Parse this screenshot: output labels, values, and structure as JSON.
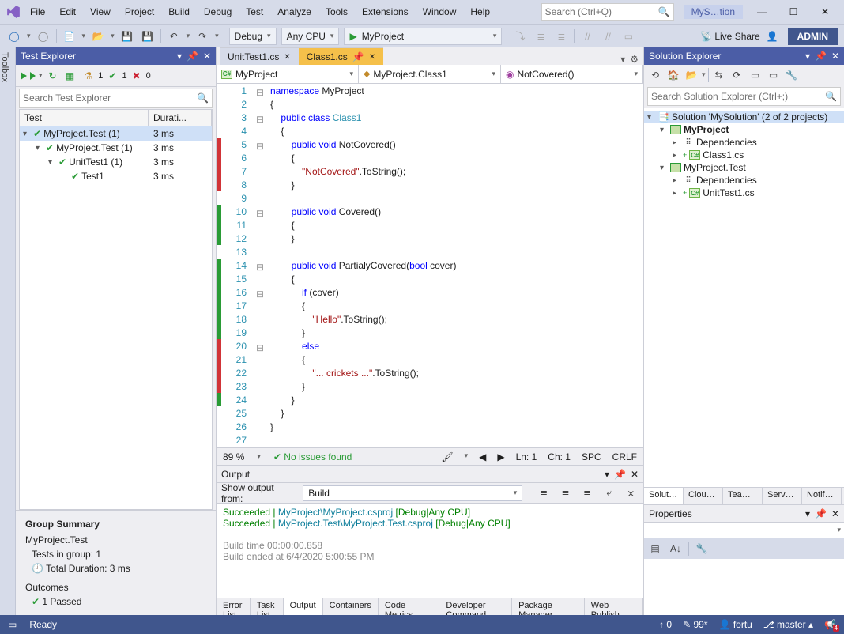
{
  "title_bar": {
    "solution_name": "MyS…tion"
  },
  "menu": [
    "File",
    "Edit",
    "View",
    "Project",
    "Build",
    "Debug",
    "Test",
    "Analyze",
    "Tools",
    "Extensions",
    "Window",
    "Help"
  ],
  "title_search_placeholder": "Search (Ctrl+Q)",
  "toolbar": {
    "config": "Debug",
    "platform": "Any CPU",
    "start_project": "MyProject",
    "live_share": "Live Share",
    "admin": "ADMIN"
  },
  "toolbox_label": "Toolbox",
  "test_explorer": {
    "title": "Test Explorer",
    "counts": {
      "flask": "1",
      "pass": "1",
      "fail": "0"
    },
    "search_placeholder": "Search Test Explorer",
    "col_test": "Test",
    "col_dur": "Durati...",
    "rows": [
      {
        "indent": 0,
        "name": "MyProject.Test  (1)",
        "dur": "3 ms",
        "sel": true
      },
      {
        "indent": 1,
        "name": "MyProject.Test  (1)",
        "dur": "3 ms"
      },
      {
        "indent": 2,
        "name": "UnitTest1  (1)",
        "dur": "3 ms"
      },
      {
        "indent": 3,
        "name": "Test1",
        "dur": "3 ms",
        "leaf": true
      }
    ],
    "summary": {
      "title": "Group Summary",
      "group": "MyProject.Test",
      "tests_in_group": "Tests in group:  1",
      "total_duration": "Total Duration:  3  ms",
      "outcomes": "Outcomes",
      "passed": "1  Passed"
    }
  },
  "doc_tabs": [
    {
      "label": "UnitTest1.cs",
      "active": false
    },
    {
      "label": "Class1.cs",
      "active": true
    }
  ],
  "nav": {
    "scope": "MyProject",
    "class": "MyProject.Class1",
    "member": "NotCovered()"
  },
  "code": [
    {
      "n": 1,
      "cov": "",
      "o": "⊟",
      "h": "<span class='kw'>namespace</span> MyProject"
    },
    {
      "n": 2,
      "cov": "",
      "o": "",
      "h": "{"
    },
    {
      "n": 3,
      "cov": "",
      "o": "⊟",
      "h": "    <span class='kw'>public</span> <span class='kw'>class</span> <span class='cls'>Class1</span>"
    },
    {
      "n": 4,
      "cov": "",
      "o": "",
      "h": "    {"
    },
    {
      "n": 5,
      "cov": "#d13438",
      "o": "⊟",
      "h": "        <span class='kw'>public</span> <span class='kw'>void</span> NotCovered()"
    },
    {
      "n": 6,
      "cov": "#d13438",
      "o": "",
      "h": "        {"
    },
    {
      "n": 7,
      "cov": "#d13438",
      "o": "",
      "h": "            <span class='str'>\"NotCovered\"</span>.ToString();"
    },
    {
      "n": 8,
      "cov": "#d13438",
      "o": "",
      "h": "        }"
    },
    {
      "n": 9,
      "cov": "",
      "o": "",
      "h": ""
    },
    {
      "n": 10,
      "cov": "#2a9b36",
      "o": "⊟",
      "h": "        <span class='kw'>public</span> <span class='kw'>void</span> Covered()"
    },
    {
      "n": 11,
      "cov": "#2a9b36",
      "o": "",
      "h": "        {"
    },
    {
      "n": 12,
      "cov": "#2a9b36",
      "o": "",
      "h": "        }"
    },
    {
      "n": 13,
      "cov": "",
      "o": "",
      "h": ""
    },
    {
      "n": 14,
      "cov": "#2a9b36",
      "o": "⊟",
      "h": "        <span class='kw'>public</span> <span class='kw'>void</span> PartialyCovered(<span class='kw'>bool</span> cover)"
    },
    {
      "n": 15,
      "cov": "#2a9b36",
      "o": "",
      "h": "        {"
    },
    {
      "n": 16,
      "cov": "#2a9b36",
      "o": "⊟",
      "h": "            <span class='kw'>if</span> (cover)"
    },
    {
      "n": 17,
      "cov": "#2a9b36",
      "o": "",
      "h": "            {"
    },
    {
      "n": 18,
      "cov": "#2a9b36",
      "o": "",
      "h": "                <span class='str'>\"Hello\"</span>.ToString();"
    },
    {
      "n": 19,
      "cov": "#2a9b36",
      "o": "",
      "h": "            }"
    },
    {
      "n": 20,
      "cov": "#d13438",
      "o": "⊟",
      "h": "            <span class='kw'>else</span>"
    },
    {
      "n": 21,
      "cov": "#d13438",
      "o": "",
      "h": "            {"
    },
    {
      "n": 22,
      "cov": "#d13438",
      "o": "",
      "h": "                <span class='str'>\"... crickets ...\"</span>.ToString();"
    },
    {
      "n": 23,
      "cov": "#d13438",
      "o": "",
      "h": "            }"
    },
    {
      "n": 24,
      "cov": "#2a9b36",
      "o": "",
      "h": "        }"
    },
    {
      "n": 25,
      "cov": "",
      "o": "",
      "h": "    }"
    },
    {
      "n": 26,
      "cov": "",
      "o": "",
      "h": "}"
    },
    {
      "n": 27,
      "cov": "",
      "o": "",
      "h": ""
    }
  ],
  "editor_status": {
    "zoom": "89 %",
    "issues": "No issues found",
    "ln": "Ln: 1",
    "ch": "Ch: 1",
    "spc": "SPC",
    "crlf": "CRLF"
  },
  "output": {
    "title": "Output",
    "show_from_label": "Show output from:",
    "show_from_value": "Build",
    "lines": [
      {
        "type": "ok",
        "text": "Succeeded | ",
        "name": "MyProject\\MyProject.csproj",
        "suffix": " [Debug|Any CPU]"
      },
      {
        "type": "ok",
        "text": "Succeeded | ",
        "name": "MyProject.Test\\MyProject.Test.csproj",
        "suffix": " [Debug|Any CPU]"
      },
      {
        "type": "plain",
        "text": ""
      },
      {
        "type": "plain",
        "text": "Build time 00:00:00.858"
      },
      {
        "type": "plain",
        "text": "Build ended at 6/4/2020 5:00:55 PM"
      }
    ]
  },
  "bottom_tabs": [
    "Error List",
    "Task List",
    "Output",
    "Containers",
    "Code Metrics Results",
    "Developer Command Pr…",
    "Package Manager Cons…",
    "Web Publish Activity"
  ],
  "solution": {
    "title": "Solution Explorer",
    "search_placeholder": "Search Solution Explorer (Ctrl+;)",
    "root": "Solution 'MySolution' (2 of 2 projects)",
    "tree": [
      {
        "indent": 0,
        "icon": "proj",
        "label": "MyProject",
        "bold": true,
        "exp": "▾"
      },
      {
        "indent": 1,
        "icon": "dep",
        "label": "Dependencies",
        "exp": "▸"
      },
      {
        "indent": 1,
        "icon": "cs",
        "label": "Class1.cs",
        "exp": "▸",
        "plus": true
      },
      {
        "indent": 0,
        "icon": "proj",
        "label": "MyProject.Test",
        "exp": "▾"
      },
      {
        "indent": 1,
        "icon": "dep",
        "label": "Dependencies",
        "exp": "▸"
      },
      {
        "indent": 1,
        "icon": "cs",
        "label": "UnitTest1.cs",
        "exp": "▸",
        "plus": true
      }
    ],
    "tabs": [
      "Solut…",
      "Clou…",
      "Team…",
      "Serve…",
      "Notif…"
    ]
  },
  "properties": {
    "title": "Properties"
  },
  "status_bar": {
    "ready": "Ready",
    "up": "0",
    "pencil": "99*",
    "user": "fortu",
    "branch": "master",
    "bell": "4"
  }
}
